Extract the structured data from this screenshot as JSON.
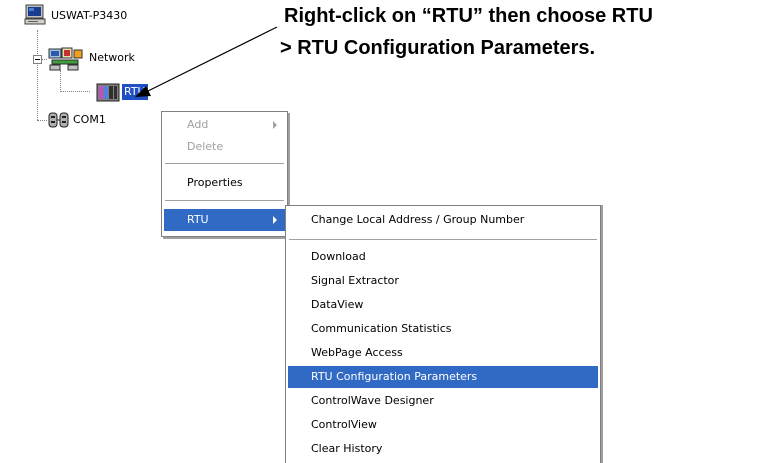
{
  "tree": {
    "root_label": "USWAT-P3430",
    "network_label": "Network",
    "rtu_label": "RTU",
    "com_label": "COM1"
  },
  "annotation": {
    "line1": "Right-click on “RTU” then choose RTU",
    "line2": "> RTU Configuration Parameters."
  },
  "context_menu": {
    "items": [
      {
        "label": "Add",
        "enabled": false,
        "submenu": true
      },
      {
        "label": "Delete",
        "enabled": false
      },
      {
        "label": "Properties",
        "enabled": true
      },
      {
        "label": "RTU",
        "enabled": true,
        "submenu": true,
        "highlighted": true
      }
    ]
  },
  "rtu_submenu": {
    "items": [
      {
        "label": "Change Local Address / Group Number"
      },
      {
        "label": "Download"
      },
      {
        "label": "Signal Extractor"
      },
      {
        "label": "DataView"
      },
      {
        "label": "Communication Statistics"
      },
      {
        "label": "WebPage Access"
      },
      {
        "label": "RTU Configuration Parameters",
        "highlighted": true
      },
      {
        "label": "ControlWave Designer"
      },
      {
        "label": "ControlView"
      },
      {
        "label": "Clear History"
      }
    ]
  },
  "colors": {
    "selection": "#316ac5",
    "tree_selection": "#1f4fc3",
    "disabled_text": "#a0a0a0"
  }
}
